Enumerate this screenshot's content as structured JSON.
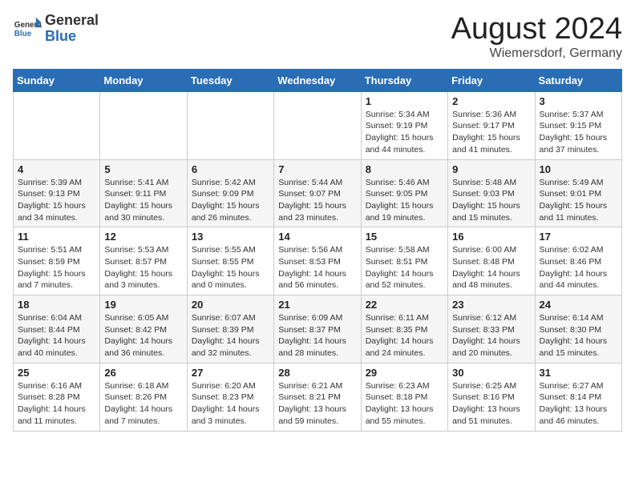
{
  "logo": {
    "general": "General",
    "blue": "Blue"
  },
  "title": "August 2024",
  "location": "Wiemersdorf, Germany",
  "days_of_week": [
    "Sunday",
    "Monday",
    "Tuesday",
    "Wednesday",
    "Thursday",
    "Friday",
    "Saturday"
  ],
  "weeks": [
    [
      {
        "day": "",
        "info": ""
      },
      {
        "day": "",
        "info": ""
      },
      {
        "day": "",
        "info": ""
      },
      {
        "day": "",
        "info": ""
      },
      {
        "day": "1",
        "info": "Sunrise: 5:34 AM\nSunset: 9:19 PM\nDaylight: 15 hours and 44 minutes."
      },
      {
        "day": "2",
        "info": "Sunrise: 5:36 AM\nSunset: 9:17 PM\nDaylight: 15 hours and 41 minutes."
      },
      {
        "day": "3",
        "info": "Sunrise: 5:37 AM\nSunset: 9:15 PM\nDaylight: 15 hours and 37 minutes."
      }
    ],
    [
      {
        "day": "4",
        "info": "Sunrise: 5:39 AM\nSunset: 9:13 PM\nDaylight: 15 hours and 34 minutes."
      },
      {
        "day": "5",
        "info": "Sunrise: 5:41 AM\nSunset: 9:11 PM\nDaylight: 15 hours and 30 minutes."
      },
      {
        "day": "6",
        "info": "Sunrise: 5:42 AM\nSunset: 9:09 PM\nDaylight: 15 hours and 26 minutes."
      },
      {
        "day": "7",
        "info": "Sunrise: 5:44 AM\nSunset: 9:07 PM\nDaylight: 15 hours and 23 minutes."
      },
      {
        "day": "8",
        "info": "Sunrise: 5:46 AM\nSunset: 9:05 PM\nDaylight: 15 hours and 19 minutes."
      },
      {
        "day": "9",
        "info": "Sunrise: 5:48 AM\nSunset: 9:03 PM\nDaylight: 15 hours and 15 minutes."
      },
      {
        "day": "10",
        "info": "Sunrise: 5:49 AM\nSunset: 9:01 PM\nDaylight: 15 hours and 11 minutes."
      }
    ],
    [
      {
        "day": "11",
        "info": "Sunrise: 5:51 AM\nSunset: 8:59 PM\nDaylight: 15 hours and 7 minutes."
      },
      {
        "day": "12",
        "info": "Sunrise: 5:53 AM\nSunset: 8:57 PM\nDaylight: 15 hours and 3 minutes."
      },
      {
        "day": "13",
        "info": "Sunrise: 5:55 AM\nSunset: 8:55 PM\nDaylight: 15 hours and 0 minutes."
      },
      {
        "day": "14",
        "info": "Sunrise: 5:56 AM\nSunset: 8:53 PM\nDaylight: 14 hours and 56 minutes."
      },
      {
        "day": "15",
        "info": "Sunrise: 5:58 AM\nSunset: 8:51 PM\nDaylight: 14 hours and 52 minutes."
      },
      {
        "day": "16",
        "info": "Sunrise: 6:00 AM\nSunset: 8:48 PM\nDaylight: 14 hours and 48 minutes."
      },
      {
        "day": "17",
        "info": "Sunrise: 6:02 AM\nSunset: 8:46 PM\nDaylight: 14 hours and 44 minutes."
      }
    ],
    [
      {
        "day": "18",
        "info": "Sunrise: 6:04 AM\nSunset: 8:44 PM\nDaylight: 14 hours and 40 minutes."
      },
      {
        "day": "19",
        "info": "Sunrise: 6:05 AM\nSunset: 8:42 PM\nDaylight: 14 hours and 36 minutes."
      },
      {
        "day": "20",
        "info": "Sunrise: 6:07 AM\nSunset: 8:39 PM\nDaylight: 14 hours and 32 minutes."
      },
      {
        "day": "21",
        "info": "Sunrise: 6:09 AM\nSunset: 8:37 PM\nDaylight: 14 hours and 28 minutes."
      },
      {
        "day": "22",
        "info": "Sunrise: 6:11 AM\nSunset: 8:35 PM\nDaylight: 14 hours and 24 minutes."
      },
      {
        "day": "23",
        "info": "Sunrise: 6:12 AM\nSunset: 8:33 PM\nDaylight: 14 hours and 20 minutes."
      },
      {
        "day": "24",
        "info": "Sunrise: 6:14 AM\nSunset: 8:30 PM\nDaylight: 14 hours and 15 minutes."
      }
    ],
    [
      {
        "day": "25",
        "info": "Sunrise: 6:16 AM\nSunset: 8:28 PM\nDaylight: 14 hours and 11 minutes."
      },
      {
        "day": "26",
        "info": "Sunrise: 6:18 AM\nSunset: 8:26 PM\nDaylight: 14 hours and 7 minutes."
      },
      {
        "day": "27",
        "info": "Sunrise: 6:20 AM\nSunset: 8:23 PM\nDaylight: 14 hours and 3 minutes."
      },
      {
        "day": "28",
        "info": "Sunrise: 6:21 AM\nSunset: 8:21 PM\nDaylight: 13 hours and 59 minutes."
      },
      {
        "day": "29",
        "info": "Sunrise: 6:23 AM\nSunset: 8:18 PM\nDaylight: 13 hours and 55 minutes."
      },
      {
        "day": "30",
        "info": "Sunrise: 6:25 AM\nSunset: 8:16 PM\nDaylight: 13 hours and 51 minutes."
      },
      {
        "day": "31",
        "info": "Sunrise: 6:27 AM\nSunset: 8:14 PM\nDaylight: 13 hours and 46 minutes."
      }
    ]
  ]
}
